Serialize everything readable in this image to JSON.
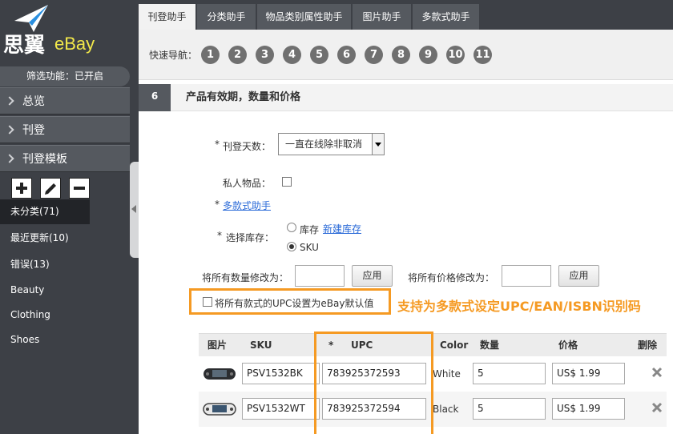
{
  "app": {
    "logo_cn": "思翼",
    "logo_en": "eBay",
    "filter_status": "筛选功能：已开启"
  },
  "sidebar": {
    "nav": [
      {
        "label": "总览"
      },
      {
        "label": "刊登"
      },
      {
        "label": "刊登模板"
      }
    ],
    "categories": [
      {
        "label": "未分类(71)",
        "active": true
      },
      {
        "label": "最近更新(10)"
      },
      {
        "label": "错误(13)"
      },
      {
        "label": "Beauty"
      },
      {
        "label": "Clothing"
      },
      {
        "label": "Shoes"
      }
    ]
  },
  "tabs": [
    {
      "label": "刊登助手",
      "active": true
    },
    {
      "label": "分类助手"
    },
    {
      "label": "物品类别属性助手"
    },
    {
      "label": "图片助手"
    },
    {
      "label": "多款式助手"
    }
  ],
  "quicknav": {
    "label": "快速导航：",
    "steps": [
      "1",
      "2",
      "3",
      "4",
      "5",
      "6",
      "7",
      "8",
      "9",
      "10",
      "11"
    ]
  },
  "section": {
    "number": "6",
    "title": "产品有效期，数量和价格"
  },
  "form": {
    "required_mark": "*",
    "duration_label": "刊登天数：",
    "duration_value": "一直在线除非取消",
    "private_label": "私人物品：",
    "variation_link": "多款式助手",
    "stock_label": "选择库存：",
    "stock_option_1": "库存",
    "stock_new_link": "新建库存",
    "stock_option_2": "SKU",
    "bulk_qty_label": "将所有数量修改为：",
    "bulk_price_label": "将所有价格修改为：",
    "apply_label": "应用",
    "upc_default_label": "将所有款式的UPC设置为eBay默认值",
    "promo_text": "支持为多款式设定UPC/EAN/ISBN识别码"
  },
  "table": {
    "headers": {
      "image": "图片",
      "sku": "SKU",
      "upc_star": "*",
      "upc": "UPC",
      "color": "Color",
      "qty": "数量",
      "price": "价格",
      "delete": "删除"
    },
    "rows": [
      {
        "sku": "PSV1532BK",
        "upc": "783925372593",
        "color": "White",
        "qty": "5",
        "price": "US$ 1.99"
      },
      {
        "sku": "PSV1532WT",
        "upc": "783925372594",
        "color": "Black",
        "qty": "5",
        "price": "US$ 1.99"
      }
    ]
  },
  "colors": {
    "sidebar_bg": "#3d4046",
    "accent_orange": "#f59a23",
    "link_blue": "#2a6ad8",
    "logo_yellow": "#f2e84a"
  }
}
